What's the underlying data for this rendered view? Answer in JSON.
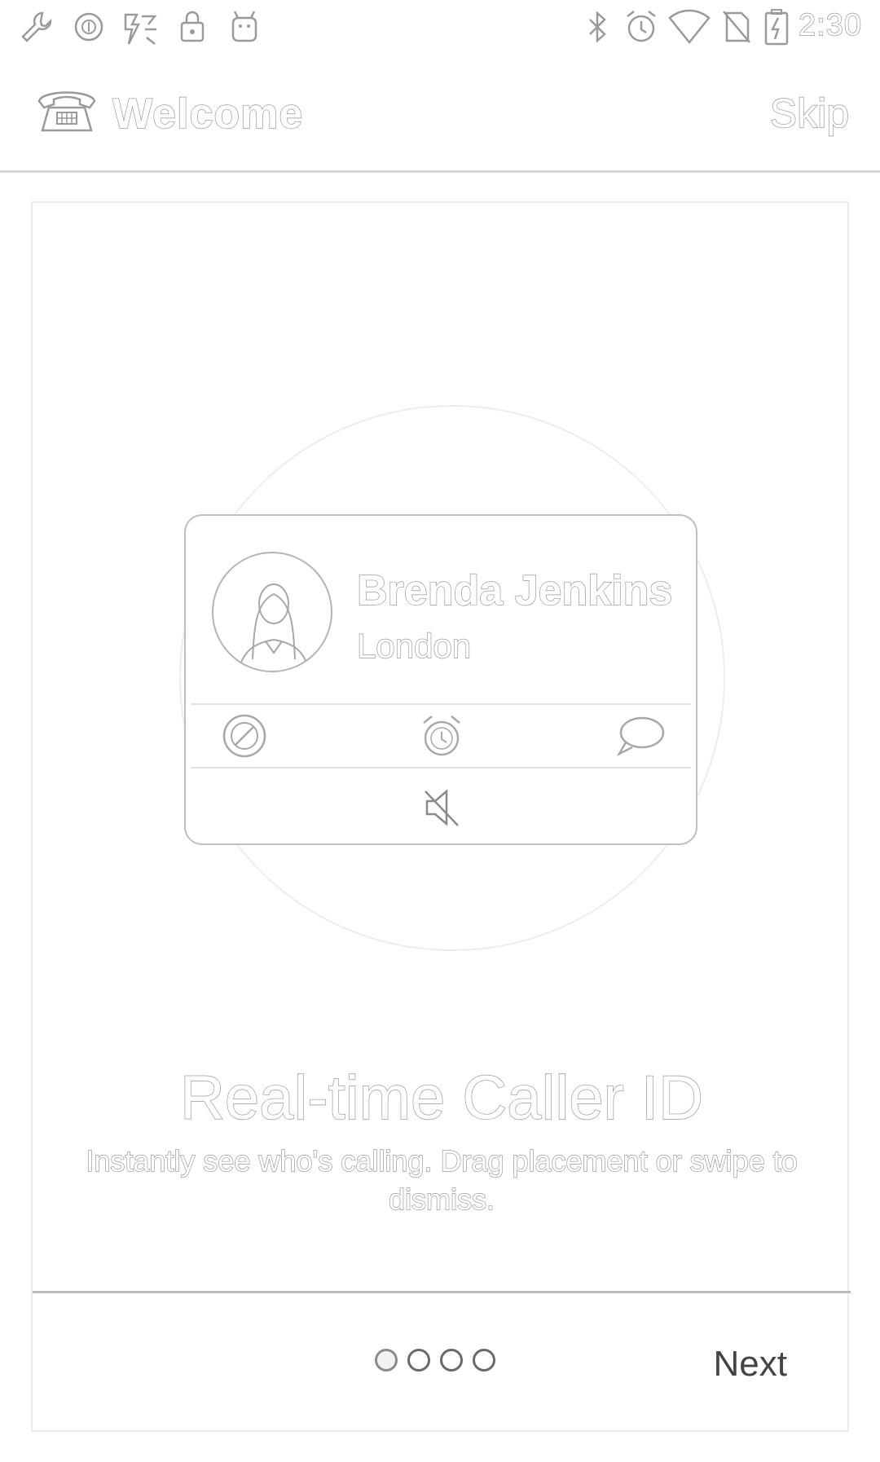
{
  "status_bar": {
    "time": "2:30",
    "left_icons": [
      "wrench-icon",
      "sync-icon",
      "signal-off-icon",
      "lock-icon",
      "android-icon"
    ],
    "right_icons": [
      "bluetooth-icon",
      "alarm-icon",
      "wifi-icon",
      "no-sim-icon",
      "battery-charging-icon"
    ]
  },
  "app_bar": {
    "title": "Welcome",
    "skip_label": "Skip",
    "logo_icon": "telephone-icon"
  },
  "caller_card": {
    "name": "Brenda Jenkins",
    "location": "London",
    "actions": [
      "block-icon",
      "alarm-reminder-icon",
      "message-icon"
    ],
    "mute_icon": "mute-icon"
  },
  "feature": {
    "title": "Real-time Caller ID",
    "description": "Instantly see who's calling. Drag placement or swipe to dismiss."
  },
  "pager": {
    "page_count": 4,
    "current_page": 1,
    "next_label": "Next"
  }
}
